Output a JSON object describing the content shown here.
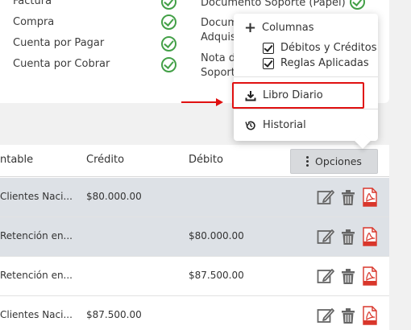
{
  "documents": {
    "left": [
      {
        "label": "Factura",
        "checked": true
      },
      {
        "label": "Compra",
        "checked": true
      },
      {
        "label": "Cuenta por Pagar",
        "checked": true
      },
      {
        "label": "Cuenta por Cobrar",
        "checked": true
      }
    ],
    "right": {
      "item1": "Documento Soporte (Papel)",
      "item2_line1": "Documento",
      "item2_line2": "Adquisic",
      "item3_line1": "Nota d",
      "item3_line2": "Soport"
    }
  },
  "table": {
    "headers": {
      "account": "ntable",
      "credit": "Crédito",
      "debit": "Débito"
    },
    "options_label": "Opciones",
    "rows": [
      {
        "account": "Clientes Naci...",
        "credit": "$80.000.00",
        "debit": "",
        "shaded": true
      },
      {
        "account": "Retención en...",
        "credit": "",
        "debit": "$80.000.00",
        "shaded": true
      },
      {
        "account": "Retención en...",
        "credit": "",
        "debit": "$87.500.00",
        "shaded": false
      },
      {
        "account": "Clientes Naci...",
        "credit": "$87.500.00",
        "debit": "",
        "shaded": false
      }
    ]
  },
  "menu": {
    "columns_label": "Columnas",
    "option_debits_credits": "Débitos y Créditos",
    "option_rules": "Reglas Aplicadas",
    "libro_diario": "Libro Diario",
    "historial": "Historial"
  },
  "colors": {
    "accent_green": "#43a047",
    "highlight_red": "#e01010",
    "pdf_red": "#d9362b"
  }
}
